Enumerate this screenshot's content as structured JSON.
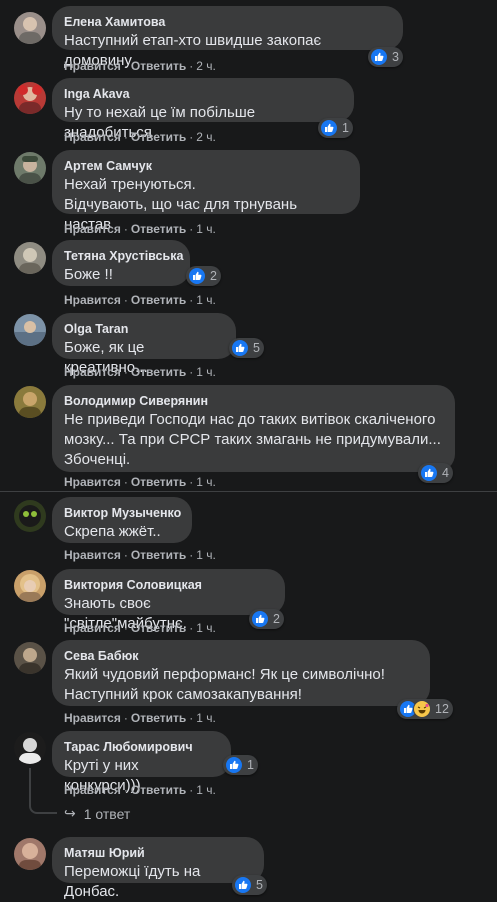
{
  "labels": {
    "like": "Нравится",
    "reply": "Ответить",
    "dot": "·"
  },
  "comments": [
    {
      "author": "Елена Хамитова",
      "text": "Наступний етап-хто швидше закопає домовину",
      "time": "2 ч.",
      "reactions": "3",
      "avatar_color": "#9a8f8a"
    },
    {
      "author": "Inga Akava",
      "text": "Ну то нехай це їм побільше знадобиться",
      "time": "2 ч.",
      "reactions": "1",
      "avatar_color": "#b83a36"
    },
    {
      "author": "Артем Самчук",
      "text": "Нехай тренуються.\nВідчувають, що час для трнувань настав",
      "time": "1 ч.",
      "reactions": "",
      "avatar_color": "#6e7a6a"
    },
    {
      "author": "Тетяна Хрустівська",
      "text": "Боже !!",
      "time": "1 ч.",
      "reactions": "2",
      "avatar_color": "#8f8c82"
    },
    {
      "author": "Olga Taran",
      "text": "Боже, як це креативно...",
      "time": "1 ч.",
      "reactions": "5",
      "avatar_color": "#7d93a8"
    },
    {
      "author": "Володимир Сиверянин",
      "text": "Не приведи Господи нас до таких витівок скаліченого мозку... Та при СРСР таких змагань не придумували... Збоченці.",
      "time": "1 ч.",
      "reactions": "4",
      "avatar_color": "#8a7a3c"
    },
    {
      "author": "Виктор Музыченко",
      "text": "Скрепа жжёт..",
      "time": "1 ч.",
      "reactions": "",
      "avatar_color": "#2f3a1e"
    },
    {
      "author": "Виктория Соловицкая",
      "text": "Знають своє \"світле\"майбутнє.",
      "time": "1 ч.",
      "reactions": "2",
      "avatar_color": "#c9a06a"
    },
    {
      "author": "Сева Бабюк",
      "text": "Який чудовий перформанс! Як це символічно!\nНаступний крок самозакапування!",
      "time": "1 ч.",
      "reactions": "12",
      "avatar_color": "#5a5247"
    },
    {
      "author": "Тарас Любомирович",
      "text": "Круті у них конкурси)))",
      "time": "1 ч.",
      "reactions": "1",
      "avatar_color": "#1c1c1c"
    },
    {
      "author": "Матяш Юрий",
      "text": "Переможці їдуть на Донбас.",
      "time": "1 ч.",
      "reactions": "5",
      "avatar_color": "#a0786a"
    }
  ],
  "reply_link": {
    "arrow": "↪",
    "label": "1 ответ"
  },
  "colors": {
    "like_blue": "#1877f2",
    "bubble": "#3a3b3c",
    "background": "#18191a",
    "haha_yellow": "#f7c64a"
  }
}
